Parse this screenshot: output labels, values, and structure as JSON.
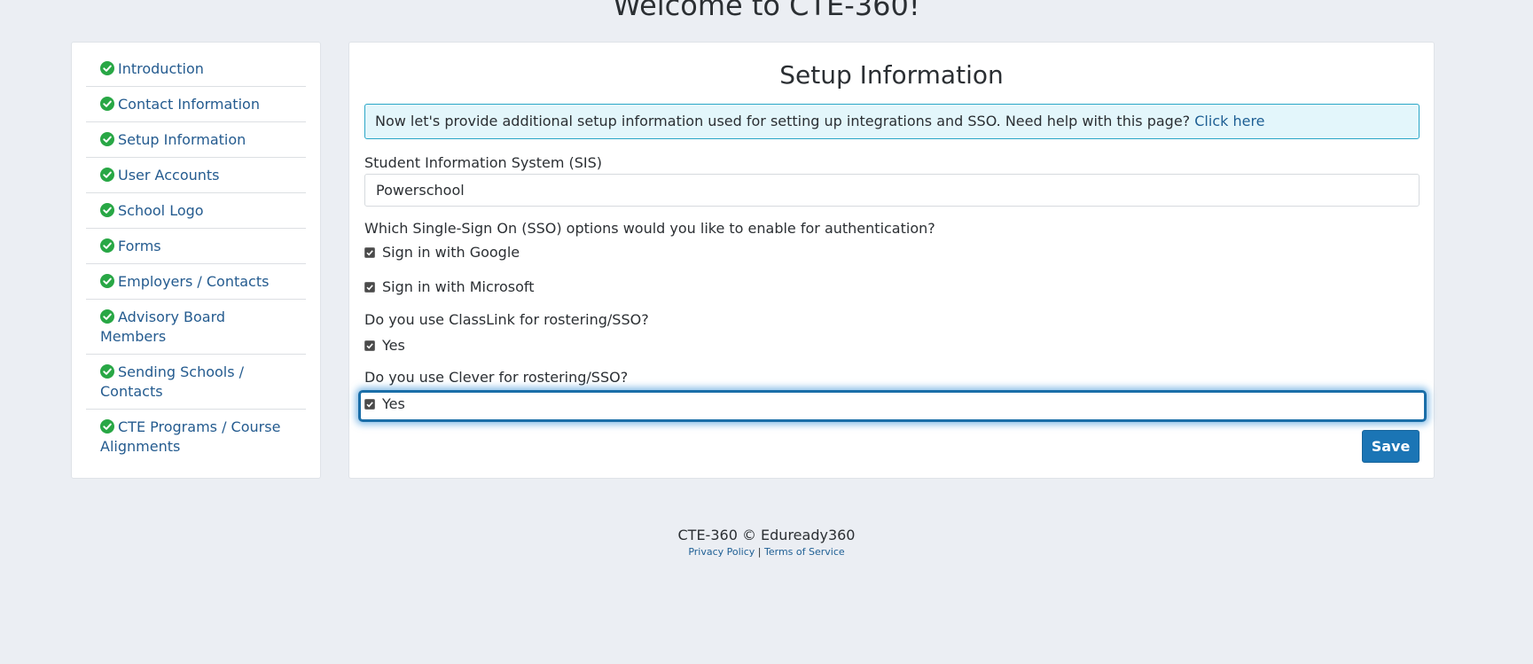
{
  "page": {
    "heading": "Welcome to CTE-360!"
  },
  "sidebar": {
    "items": [
      {
        "label": "Introduction",
        "status_icon": "check-circle-icon"
      },
      {
        "label": "Contact Information",
        "status_icon": "check-circle-icon"
      },
      {
        "label": "Setup Information",
        "status_icon": "check-circle-icon"
      },
      {
        "label": "User Accounts",
        "status_icon": "check-circle-icon"
      },
      {
        "label": "School Logo",
        "status_icon": "check-circle-icon"
      },
      {
        "label": "Forms",
        "status_icon": "check-circle-icon"
      },
      {
        "label": "Employers / Contacts",
        "status_icon": "check-circle-icon"
      },
      {
        "label": "Advisory Board Members",
        "status_icon": "check-circle-icon"
      },
      {
        "label": "Sending Schools / Contacts",
        "status_icon": "check-circle-icon"
      },
      {
        "label": "CTE Programs / Course Alignments",
        "status_icon": "check-circle-icon"
      }
    ]
  },
  "main": {
    "title": "Setup Information",
    "alert": {
      "text": "Now let's provide additional setup information used for setting up integrations and SSO. Need help with this page?",
      "link": "Click here"
    },
    "sis": {
      "label": "Student Information System (SIS)",
      "value": "Powerschool"
    },
    "sso": {
      "question": "Which Single-Sign On (SSO) options would you like to enable for authentication?",
      "google_label": "Sign in with Google",
      "google_checked": true,
      "microsoft_label": "Sign in with Microsoft",
      "microsoft_checked": true
    },
    "classlink": {
      "question": "Do you use ClassLink for rostering/SSO?",
      "option_label": "Yes",
      "checked": true
    },
    "clever": {
      "question": "Do you use Clever for rostering/SSO?",
      "option_label": "Yes",
      "checked": true
    },
    "save_label": "Save"
  },
  "footer": {
    "copyright": "CTE-360 © Eduready360",
    "privacy": "Privacy Policy",
    "separator": "|",
    "terms": "Terms of Service"
  },
  "colors": {
    "background": "#ebeef3",
    "link": "#245b8f",
    "check_green": "#28a745",
    "primary_button": "#1b75b5",
    "alert_border": "#2aa6c7",
    "alert_bg": "#e3f6fb"
  }
}
